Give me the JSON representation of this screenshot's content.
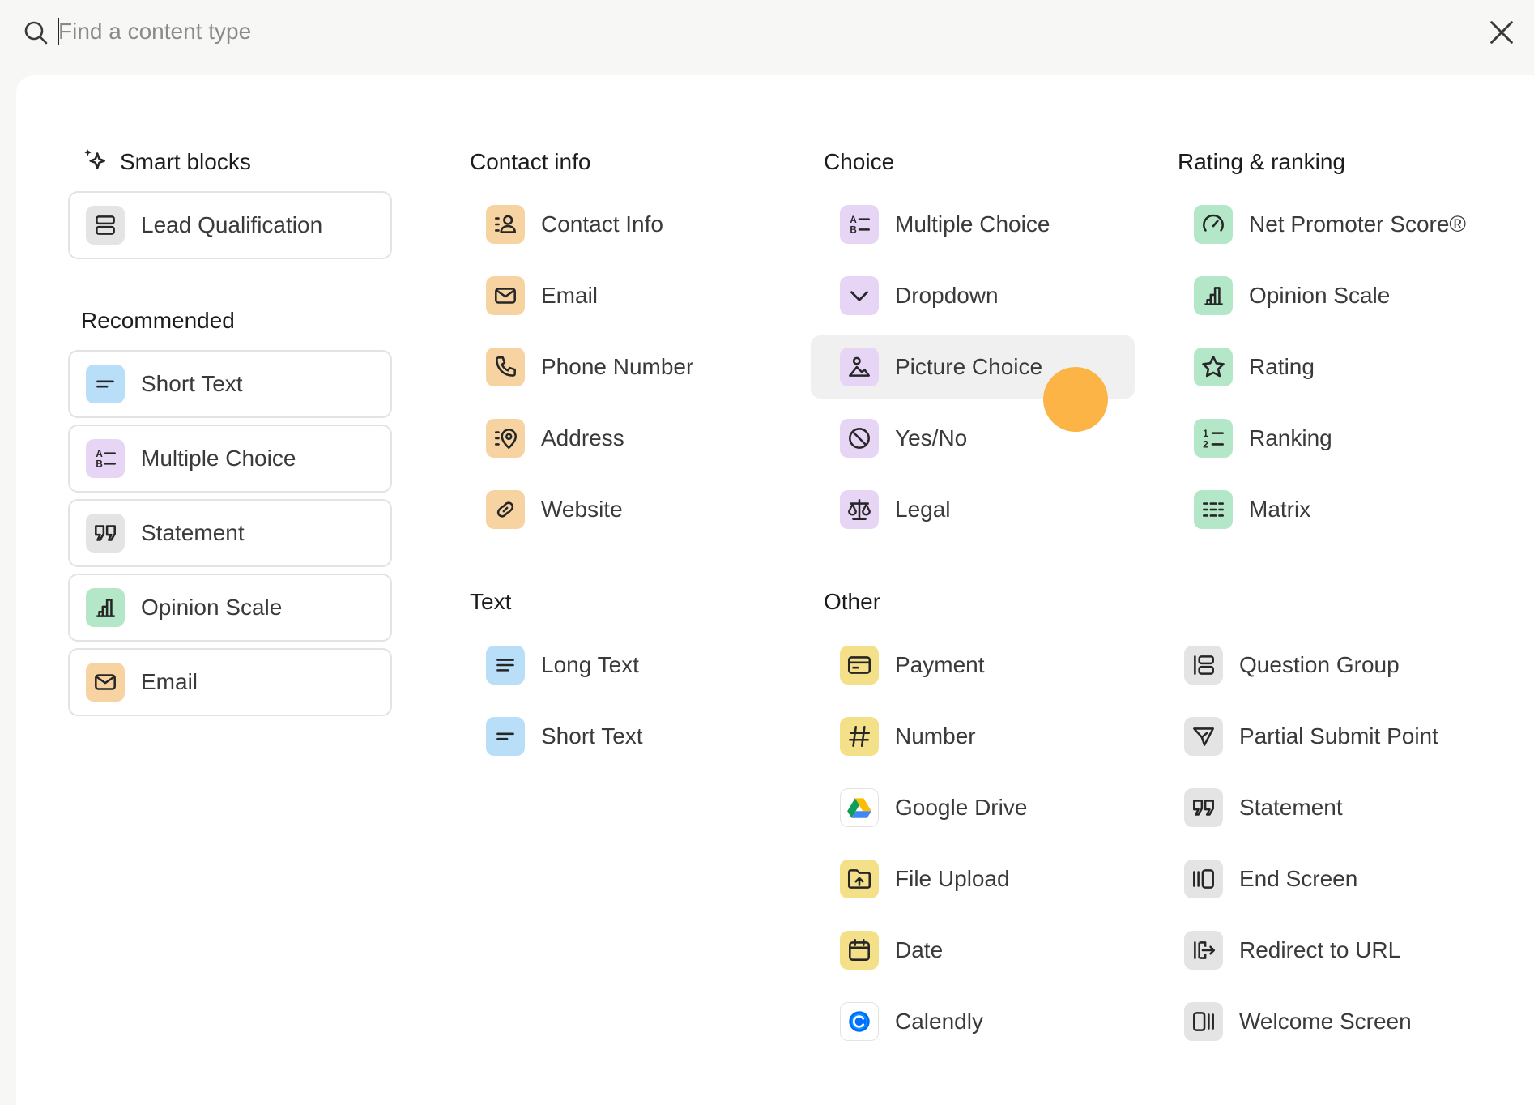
{
  "search": {
    "placeholder": "Find a content type",
    "value": ""
  },
  "sections": {
    "smart_blocks": {
      "title": "Smart blocks",
      "items": [
        {
          "label": "Lead Qualification",
          "icon": "stack-icon"
        }
      ]
    },
    "recommended": {
      "title": "Recommended",
      "items": [
        {
          "label": "Short Text",
          "icon": "short-text-icon"
        },
        {
          "label": "Multiple Choice",
          "icon": "multiple-choice-icon"
        },
        {
          "label": "Statement",
          "icon": "quote-icon"
        },
        {
          "label": "Opinion Scale",
          "icon": "bar-chart-icon"
        },
        {
          "label": "Email",
          "icon": "envelope-icon"
        }
      ]
    },
    "contact_info": {
      "title": "Contact info",
      "items": [
        {
          "label": "Contact Info",
          "icon": "contact-card-icon"
        },
        {
          "label": "Email",
          "icon": "envelope-icon"
        },
        {
          "label": "Phone Number",
          "icon": "phone-icon"
        },
        {
          "label": "Address",
          "icon": "map-pin-icon"
        },
        {
          "label": "Website",
          "icon": "link-icon"
        }
      ]
    },
    "text": {
      "title": "Text",
      "items": [
        {
          "label": "Long Text",
          "icon": "long-text-icon"
        },
        {
          "label": "Short Text",
          "icon": "short-text-icon"
        }
      ]
    },
    "choice": {
      "title": "Choice",
      "items": [
        {
          "label": "Multiple Choice",
          "icon": "multiple-choice-icon"
        },
        {
          "label": "Dropdown",
          "icon": "chevron-down-icon"
        },
        {
          "label": "Picture Choice",
          "icon": "image-icon"
        },
        {
          "label": "Yes/No",
          "icon": "yes-no-icon"
        },
        {
          "label": "Legal",
          "icon": "scales-icon"
        }
      ]
    },
    "rating": {
      "title": "Rating & ranking",
      "items": [
        {
          "label": "Net Promoter Score®",
          "icon": "gauge-icon"
        },
        {
          "label": "Opinion Scale",
          "icon": "bar-chart-icon"
        },
        {
          "label": "Rating",
          "icon": "star-icon"
        },
        {
          "label": "Ranking",
          "icon": "ranking-icon"
        },
        {
          "label": "Matrix",
          "icon": "matrix-icon"
        }
      ]
    },
    "other": {
      "title": "Other",
      "items": [
        {
          "label": "Payment",
          "icon": "credit-card-icon"
        },
        {
          "label": "Number",
          "icon": "hash-icon"
        },
        {
          "label": "Google Drive",
          "icon": "google-drive-icon"
        },
        {
          "label": "File Upload",
          "icon": "folder-upload-icon"
        },
        {
          "label": "Date",
          "icon": "calendar-icon"
        },
        {
          "label": "Calendly",
          "icon": "calendly-icon"
        }
      ]
    },
    "other_right": {
      "items": [
        {
          "label": "Question Group",
          "icon": "question-group-icon"
        },
        {
          "label": "Partial Submit Point",
          "icon": "send-icon"
        },
        {
          "label": "Statement",
          "icon": "quote-icon"
        },
        {
          "label": "End Screen",
          "icon": "end-screen-icon"
        },
        {
          "label": "Redirect to URL",
          "icon": "redirect-icon"
        },
        {
          "label": "Welcome Screen",
          "icon": "welcome-screen-icon"
        }
      ]
    }
  },
  "colors": {
    "blue": "#b9def8",
    "purple": "#e6d5f5",
    "orange": "#f7d3a1",
    "green": "#b4e7c7",
    "yellow": "#f5e08a",
    "gray": "#e4e4e4",
    "cursor": "#fbb03b"
  }
}
